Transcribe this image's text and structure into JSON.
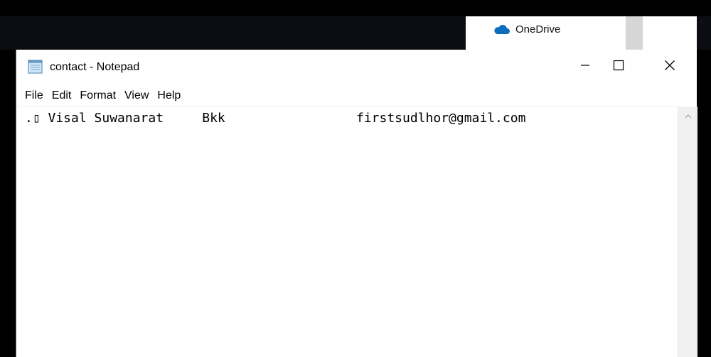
{
  "background": {
    "onedrive": {
      "label": "OneDrive",
      "icon": "onedrive-cloud-icon",
      "icon_color": "#0f6cbd"
    }
  },
  "window": {
    "title": "contact - Notepad",
    "icon": "notepad-icon",
    "controls": {
      "minimize": "minimize-icon",
      "maximize": "maximize-icon",
      "close": "close-icon"
    }
  },
  "menu": {
    "items": [
      {
        "label": "File"
      },
      {
        "label": "Edit"
      },
      {
        "label": "Format"
      },
      {
        "label": "View"
      },
      {
        "label": "Help"
      }
    ]
  },
  "editor": {
    "content": ".▯ Visal Suwanarat     Bkk                 firstsudlhor@gmail.com"
  },
  "scrollbar": {
    "up_icon": "chevron-up-icon"
  }
}
